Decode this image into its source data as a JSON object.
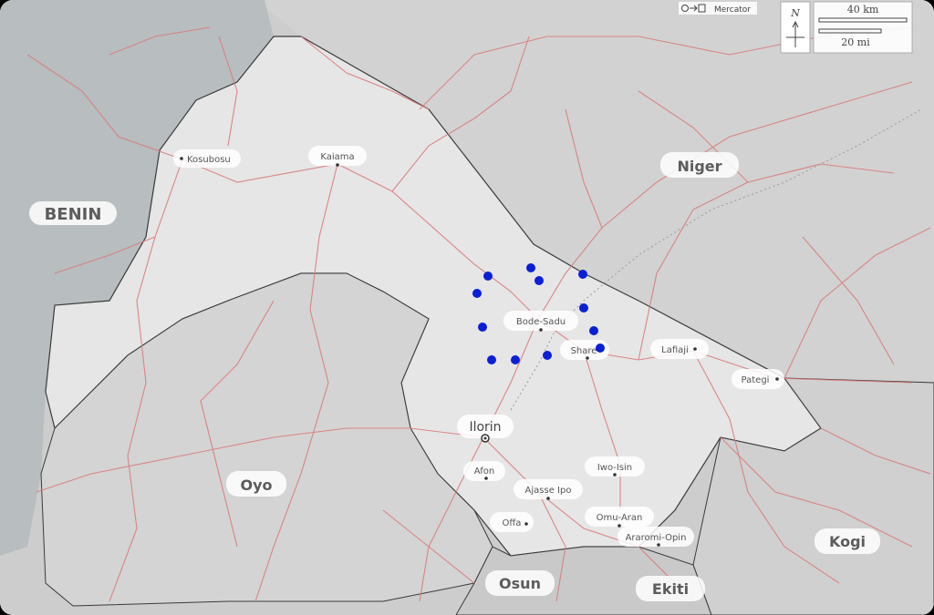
{
  "map": {
    "projection_label": "Mercator",
    "north_label": "N",
    "scale_km": "40 km",
    "scale_mi": "20 mi",
    "countries": [
      {
        "key": "benin",
        "label": "BENIN"
      }
    ],
    "regions": [
      {
        "key": "niger",
        "label": "Niger"
      },
      {
        "key": "oyo",
        "label": "Oyo"
      },
      {
        "key": "kogi",
        "label": "Kogi"
      },
      {
        "key": "osun",
        "label": "Osun"
      },
      {
        "key": "ekiti",
        "label": "Ekiti"
      }
    ],
    "towns": [
      {
        "key": "kosubosu",
        "label": "Kosubosu"
      },
      {
        "key": "kaiama",
        "label": "Kaiama"
      },
      {
        "key": "bode-sadu",
        "label": "Bode-Sadu"
      },
      {
        "key": "share",
        "label": "Share"
      },
      {
        "key": "lafiaji",
        "label": "Lafiaji"
      },
      {
        "key": "pategi",
        "label": "Pategi"
      },
      {
        "key": "afon",
        "label": "Afon"
      },
      {
        "key": "iwo-isin",
        "label": "Iwo-Isin"
      },
      {
        "key": "ajasse-ipo",
        "label": "Ajasse Ipo"
      },
      {
        "key": "offa",
        "label": "Offa"
      },
      {
        "key": "omu-aran",
        "label": "Omu-Aran"
      },
      {
        "key": "aramoko",
        "label": "Araromi-Opin"
      }
    ],
    "capital": {
      "label": "Ilorin"
    },
    "sample_points_count": 13,
    "colors": {
      "state_fill": "#e4e4e4",
      "outside_fill": "#cfcfcf",
      "benin_fill": "#b7bcbe",
      "road": "#d97c7c",
      "point": "#0b1fd6"
    }
  }
}
